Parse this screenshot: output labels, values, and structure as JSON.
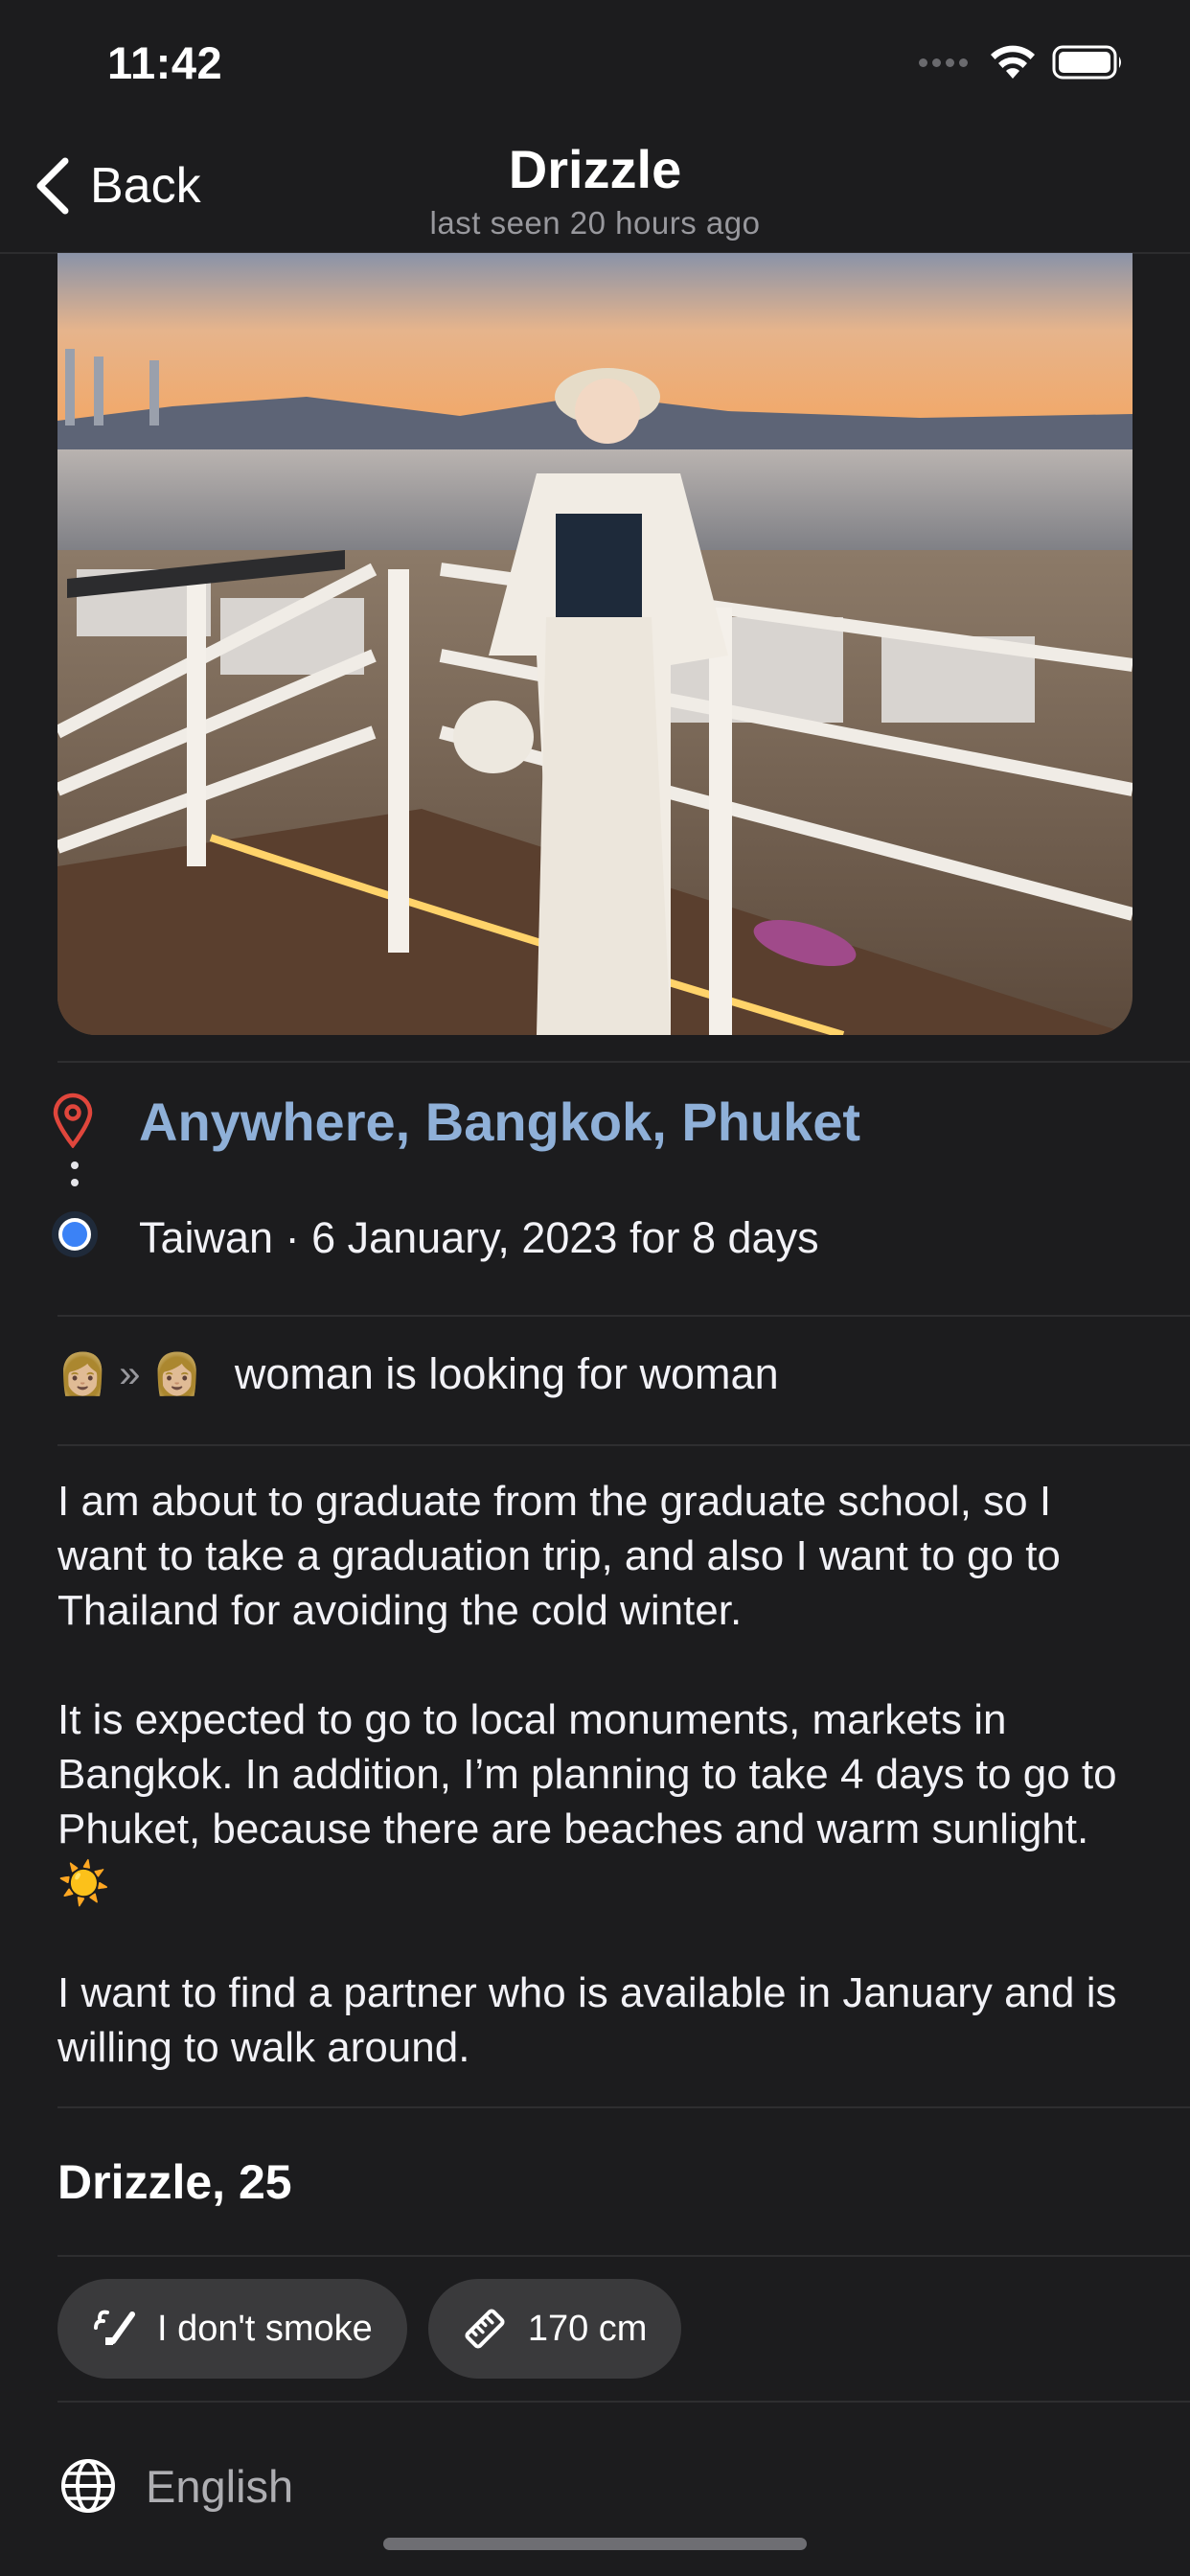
{
  "status_bar": {
    "time": "11:42"
  },
  "nav": {
    "back_label": "Back",
    "title": "Drizzle",
    "subtitle": "last seen 20 hours ago"
  },
  "route": {
    "destination": "Anywhere, Bangkok, Phuket",
    "origin_line": "Taiwan · 6 January, 2023 for 8 days"
  },
  "looking_for": {
    "from_emoji": "👩🏼",
    "arrow": "»",
    "to_emoji": "👩🏼",
    "text": "woman is looking for woman"
  },
  "description": {
    "p1": "I am about to graduate from the graduate school, so I want to take a graduation trip, and also I want to go to Thailand for avoiding the cold winter.",
    "p2": "It is expected to go to local monuments, markets in Bangkok. In addition, I’m planning to take 4 days to go to Phuket, because there are beaches and  warm sunlight.",
    "p2_emoji": "☀️",
    "p3": "I want to find a partner who is available in January and is willing to walk around."
  },
  "profile": {
    "name_age": "Drizzle, 25"
  },
  "chips": [
    {
      "label": "I don't smoke",
      "icon": "no-smoking-icon"
    },
    {
      "label": "170 cm",
      "icon": "ruler-icon"
    }
  ],
  "language": {
    "label": "English",
    "icon": "globe-icon"
  },
  "colors": {
    "background": "#1c1c1e",
    "destination": "#8fb0d8",
    "origin_dot": "#3b82f6",
    "pin": "#e0463c",
    "chip_bg": "#3a3a3c"
  }
}
